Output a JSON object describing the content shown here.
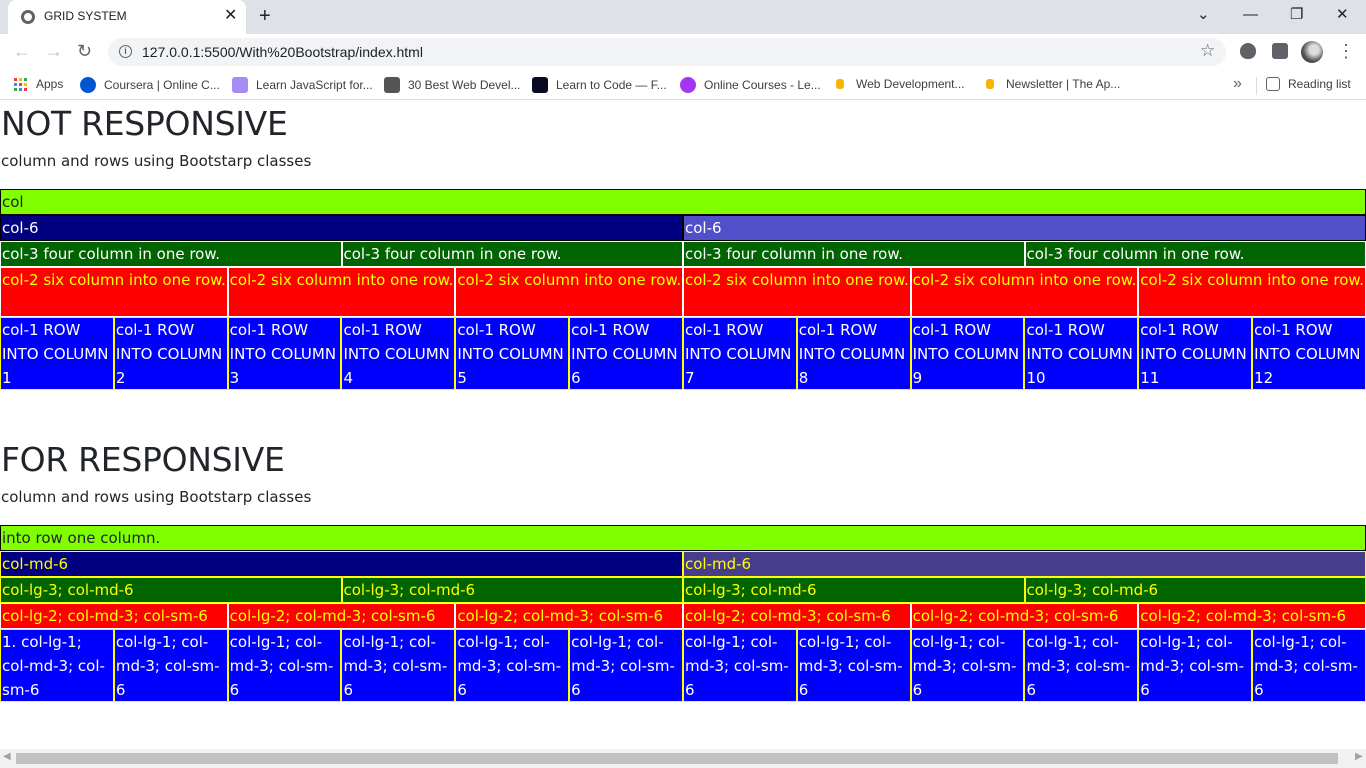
{
  "browser": {
    "tab_title": "GRID SYSTEM",
    "url": "127.0.0.1:5500/With%20Bootstrap/index.html",
    "bookmarks": [
      {
        "label": "Apps",
        "icon": "apps-grid-icon"
      },
      {
        "label": "Coursera | Online C...",
        "icon": "coursera-icon",
        "color": "#0056d2"
      },
      {
        "label": "Learn JavaScript for...",
        "icon": "javascript-icon",
        "color": "#a68cf2"
      },
      {
        "label": "30 Best Web Devel...",
        "icon": "webdev-icon",
        "color": "#555555"
      },
      {
        "label": "Learn to Code — F...",
        "icon": "freecodecamp-icon",
        "color": "#0a0a23"
      },
      {
        "label": "Online Courses - Le...",
        "icon": "udemy-icon",
        "color": "#a435f0"
      },
      {
        "label": "Web Development...",
        "icon": "bookmark-icon",
        "color": "#f4b400"
      },
      {
        "label": "Newsletter | The Ap...",
        "icon": "bookmark-icon",
        "color": "#f4b400"
      }
    ],
    "reading_list": "Reading list"
  },
  "section1": {
    "title": "NOT RESPONSIVE",
    "subtitle": "column and rows using Bootstarp classes",
    "row_col": [
      "col"
    ],
    "row_col6": [
      "col-6",
      "col-6"
    ],
    "row_col3": [
      "col-3 four column in one row.",
      "col-3 four column in one row.",
      "col-3 four column in one row.",
      "col-3 four column in one row."
    ],
    "row_col2": [
      "col-2 six column into one row.",
      "col-2 six column into one row.",
      "col-2 six column into one row.",
      "col-2 six column into one row.",
      "col-2 six column into one row.",
      "col-2 six column into one row."
    ],
    "row_col1": [
      "col-1 ROW INTO COLUMN 1",
      "col-1 ROW INTO COLUMN 2",
      "col-1 ROW INTO COLUMN 3",
      "col-1 ROW INTO COLUMN 4",
      "col-1 ROW INTO COLUMN 5",
      "col-1 ROW INTO COLUMN 6",
      "col-1 ROW INTO COLUMN 7",
      "col-1 ROW INTO COLUMN 8",
      "col-1 ROW INTO COLUMN 9",
      "col-1 ROW INTO COLUMN 10",
      "col-1 ROW INTO COLUMN 11",
      "col-1 ROW INTO COLUMN 12"
    ]
  },
  "section2": {
    "title": "FOR RESPONSIVE",
    "subtitle": "column and rows using Bootstarp classes",
    "row_col": [
      "into row one column."
    ],
    "row_col6": [
      "col-md-6",
      "col-md-6"
    ],
    "row_col3": [
      "col-lg-3; col-md-6",
      "col-lg-3; col-md-6",
      "col-lg-3; col-md-6",
      "col-lg-3; col-md-6"
    ],
    "row_col2": [
      "col-lg-2; col-md-3; col-sm-6",
      "col-lg-2; col-md-3; col-sm-6",
      "col-lg-2; col-md-3; col-sm-6",
      "col-lg-2; col-md-3; col-sm-6",
      "col-lg-2; col-md-3; col-sm-6",
      "col-lg-2; col-md-3; col-sm-6"
    ],
    "row_col1": [
      "1. col-lg-1; col-md-3; col-sm-6",
      "col-lg-1; col-md-3; col-sm-6",
      "col-lg-1; col-md-3; col-sm-6",
      "col-lg-1; col-md-3; col-sm-6",
      "col-lg-1; col-md-3; col-sm-6",
      "col-lg-1; col-md-3; col-sm-6",
      "col-lg-1; col-md-3; col-sm-6",
      "col-lg-1; col-md-3; col-sm-6",
      "col-lg-1; col-md-3; col-sm-6",
      "col-lg-1; col-md-3; col-sm-6",
      "col-lg-1; col-md-3; col-sm-6",
      "col-lg-1; col-md-3; col-sm-6"
    ]
  }
}
